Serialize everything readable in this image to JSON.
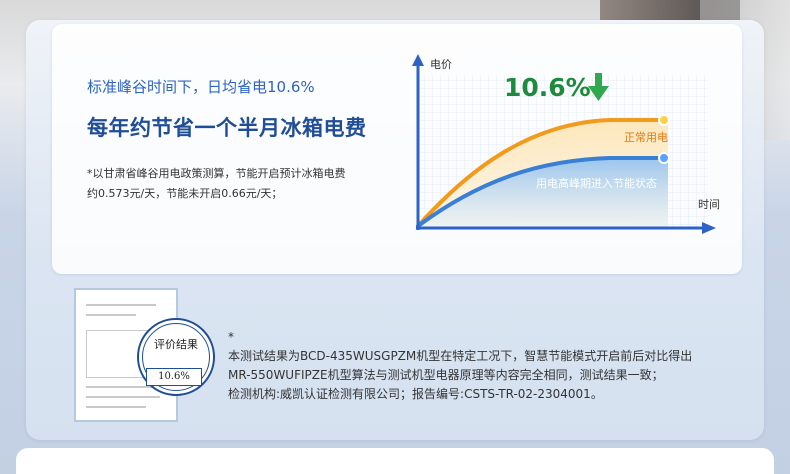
{
  "card": {
    "headline1": "标准峰谷时间下，日均省电10.6%",
    "headline2": "每年约节省一个半月冰箱电费",
    "note_line1": "*以甘肃省峰谷用电政策测算，节能开启预计冰箱电费",
    "note_line2": "约0.573元/天，节能未开启0.66元/天；"
  },
  "chart_data": {
    "type": "line",
    "ylabel": "电价",
    "xlabel": "时间",
    "badge": "10.6%",
    "series": [
      {
        "name": "正常用电",
        "color": "#f29a1b"
      },
      {
        "name": "用电高峰期进入节能状态",
        "color": "#3a7fd6"
      }
    ],
    "colors": {
      "axis": "#2d63c5",
      "arrow": "#2fa84f",
      "badge_text": "#1e8a3c"
    }
  },
  "test": {
    "asterisk": "*",
    "line1": "本测试结果为BCD-435WUSGPZM机型在特定工况下，智慧节能模式开启前后对比得出",
    "line2": "MR-550WUFIPZE机型算法与测试机型电器原理等内容完全相同，测试结果一致；",
    "line3": "检测机构:威凯认证检测有限公司；报告编号:CSTS-TR-02-2304001。",
    "seal_title": "评价结果",
    "seal_value": "10.6%"
  }
}
